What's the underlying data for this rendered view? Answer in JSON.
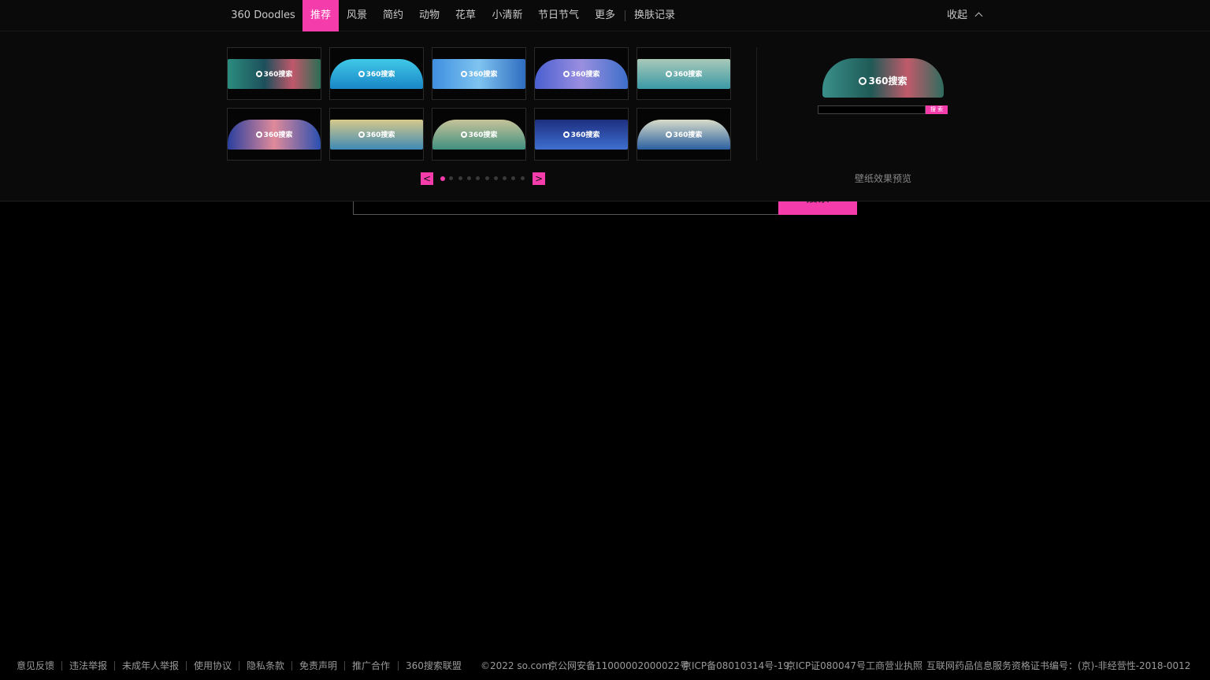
{
  "nav": {
    "items": [
      {
        "label": "360 Doodles"
      },
      {
        "label": "推荐",
        "active": true
      },
      {
        "label": "风景"
      },
      {
        "label": "简约"
      },
      {
        "label": "动物"
      },
      {
        "label": "花草"
      },
      {
        "label": "小清新"
      },
      {
        "label": "节日节气"
      },
      {
        "label": "更多"
      },
      {
        "label": "换肤记录"
      }
    ],
    "collapse_label": "收起"
  },
  "thumbnails": {
    "logo_text": "360搜索",
    "count": 10
  },
  "pager": {
    "prev": "<",
    "next": ">",
    "pages": 10,
    "current": 1
  },
  "preview": {
    "logo_text": "360搜索",
    "button_label": "搜 索",
    "caption": "壁纸效果预览"
  },
  "main_search": {
    "button_label": "搜索"
  },
  "footer": {
    "links": [
      "意见反馈",
      "违法举报",
      "未成年人举报",
      "使用协议",
      "隐私条款",
      "免责声明",
      "推广合作",
      "360搜索联盟"
    ],
    "copyright": "©2022 so.com",
    "records": [
      "京公网安备11000002000022号",
      "京ICP备08010314号-19",
      "京ICP证080047号",
      "工商营业执照",
      "互联网药品信息服务资格证书编号：(京)-非经营性-2018-0012"
    ]
  },
  "colors": {
    "accent": "#f53cab",
    "background": "#000000"
  }
}
